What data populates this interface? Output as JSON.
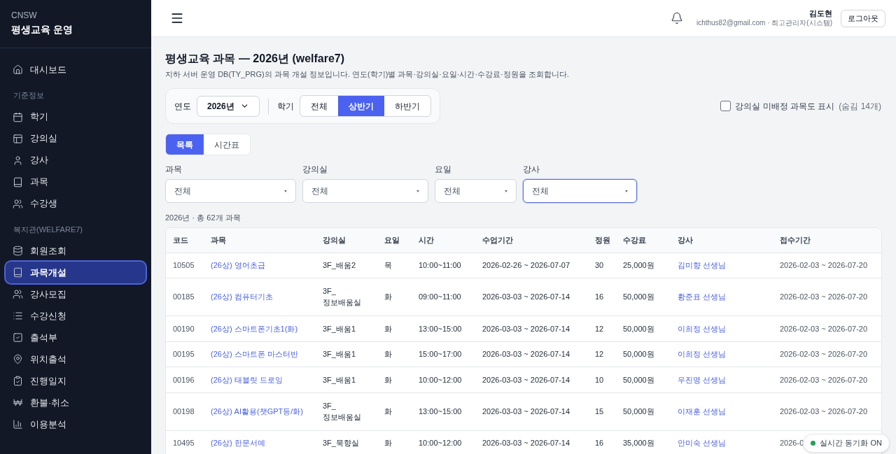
{
  "brand": {
    "org": "CNSW",
    "title": "평생교육 운영"
  },
  "sidebar": {
    "sections": [
      {
        "items": [
          {
            "label": "대시보드",
            "selected": false
          }
        ]
      },
      {
        "heading": "기준정보",
        "items": [
          {
            "label": "학기",
            "selected": false
          },
          {
            "label": "강의실",
            "selected": false
          },
          {
            "label": "강사",
            "selected": false
          },
          {
            "label": "과목",
            "selected": false
          },
          {
            "label": "수강생",
            "selected": false
          }
        ]
      },
      {
        "heading": "복지관(WELFARE7)",
        "items": [
          {
            "label": "회원조회",
            "selected": false
          },
          {
            "label": "과목개설",
            "selected": true
          },
          {
            "label": "강사모집",
            "selected": false
          },
          {
            "label": "수강신청",
            "selected": false
          },
          {
            "label": "출석부",
            "selected": false
          },
          {
            "label": "위치출석",
            "selected": false
          },
          {
            "label": "진행일지",
            "selected": false
          },
          {
            "label": "환불·취소",
            "selected": false
          },
          {
            "label": "이용분석",
            "selected": false
          }
        ]
      }
    ]
  },
  "header": {
    "user_name": "김도현",
    "user_detail": "ichthus82@gmail.com · 최고관리자(시스템)",
    "logout": "로그아웃"
  },
  "page": {
    "title": "평생교육 과목 — 2026년 (welfare7)",
    "description": "지하 서버 운영 DB(TY_PRG)의 과목 개설 정보입니다. 연도(학기)별 과목·강의실·요일·시간·수강료·정원을 조회합니다."
  },
  "year_filter": {
    "label": "연도",
    "value": "2026년"
  },
  "semester": {
    "label": "학기",
    "tabs": [
      {
        "label": "전체",
        "selected": false
      },
      {
        "label": "상반기",
        "selected": true
      },
      {
        "label": "하반기",
        "selected": false
      }
    ]
  },
  "show_unassigned": {
    "label": "강의실 미배정 과목도 표시",
    "note": "(숨김 14개)",
    "checked": false
  },
  "view_tabs": [
    {
      "label": "목록",
      "selected": true
    },
    {
      "label": "시간표",
      "selected": false
    }
  ],
  "filters": [
    {
      "label": "과목",
      "value": "전체",
      "focused": false
    },
    {
      "label": "강의실",
      "value": "전체",
      "focused": false
    },
    {
      "label": "요일",
      "value": "전체",
      "focused": false
    },
    {
      "label": "강사",
      "value": "전체",
      "focused": true
    }
  ],
  "summary": "2026년 · 총 62개 과목",
  "table": {
    "columns": [
      "코드",
      "과목",
      "강의실",
      "요일",
      "시간",
      "수업기간",
      "정원",
      "수강료",
      "강사",
      "접수기간"
    ],
    "rows": [
      [
        "10505",
        "(26상) 영어초급",
        "3F_배움2",
        "목",
        "10:00~11:00",
        "2026-02-26 ~ 2026-07-07",
        "30",
        "25,000원",
        "김미향 선생님",
        "2026-02-03 ~ 2026-07-20"
      ],
      [
        "00185",
        "(26상) 컴퓨터기초",
        "3F_ 정보배움실",
        "화",
        "09:00~11:00",
        "2026-03-03 ~ 2026-07-14",
        "16",
        "50,000원",
        "황준표 선생님",
        "2026-02-03 ~ 2026-07-20"
      ],
      [
        "00190",
        "(26상) 스마트폰기초1(화)",
        "3F_배움1",
        "화",
        "13:00~15:00",
        "2026-03-03 ~ 2026-07-14",
        "12",
        "50,000원",
        "이희정 선생님",
        "2026-02-03 ~ 2026-07-20"
      ],
      [
        "00195",
        "(26상) 스마트폰 마스터반",
        "3F_배움1",
        "화",
        "15:00~17:00",
        "2026-03-03 ~ 2026-07-14",
        "12",
        "50,000원",
        "이희정 선생님",
        "2026-02-03 ~ 2026-07-20"
      ],
      [
        "00196",
        "(26상) 태블릿 드로잉",
        "3F_배움1",
        "화",
        "10:00~12:00",
        "2026-03-03 ~ 2026-07-14",
        "10",
        "50,000원",
        "우진명 선생님",
        "2026-02-03 ~ 2026-07-20"
      ],
      [
        "00198",
        "(26상) AI활용(챗GPT등/화)",
        "3F_ 정보배움실",
        "화",
        "13:00~15:00",
        "2026-03-03 ~ 2026-07-14",
        "15",
        "50,000원",
        "이재훈 선생님",
        "2026-02-03 ~ 2026-07-20"
      ],
      [
        "10495",
        "(26상) 한문서예",
        "3F_묵향실",
        "화",
        "10:00~12:00",
        "2026-03-03 ~ 2026-07-14",
        "16",
        "35,000원",
        "안미숙 선생님",
        "2026-0"
      ]
    ]
  },
  "sync_badge": {
    "label": "실시간 동기화 ON",
    "active": true
  }
}
